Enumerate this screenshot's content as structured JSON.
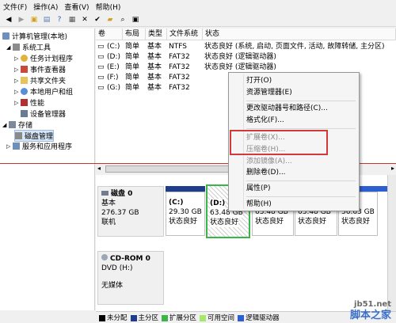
{
  "menubar": [
    "文件(F)",
    "操作(A)",
    "查看(V)",
    "帮助(H)"
  ],
  "toolbar_icons": [
    "back-icon",
    "forward-icon",
    "up-folder-icon",
    "show-tree-icon",
    "help-icon",
    "properties-icon",
    "close-icon",
    "check-icon",
    "open-icon",
    "search-icon",
    "zoom-icon"
  ],
  "tree": {
    "root": "计算机管理(本地)",
    "system_tools": "系统工具",
    "task_scheduler": "任务计划程序",
    "event_viewer": "事件查看器",
    "shared_folders": "共享文件夹",
    "local_users": "本地用户和组",
    "performance": "性能",
    "device_manager": "设备管理器",
    "storage": "存储",
    "disk_management": "磁盘管理",
    "services": "服务和应用程序"
  },
  "volume_table": {
    "headers": [
      "卷",
      "布局",
      "类型",
      "文件系统",
      "状态"
    ],
    "rows": [
      [
        "(C:)",
        "简单",
        "基本",
        "NTFS",
        "状态良好 (系统, 启动, 页面文件, 活动, 故障转储, 主分区)"
      ],
      [
        "(D:)",
        "简单",
        "基本",
        "FAT32",
        "状态良好 (逻辑驱动器)"
      ],
      [
        "(E:)",
        "简单",
        "基本",
        "FAT32",
        "状态良好 (逻辑驱动器)"
      ],
      [
        "(F:)",
        "简单",
        "基本",
        "FAT32",
        ""
      ],
      [
        "(G:)",
        "简单",
        "基本",
        "FAT32",
        ""
      ]
    ]
  },
  "disk0": {
    "name": "磁盘 0",
    "type": "基本",
    "size": "276.37 GB",
    "status": "联机",
    "partitions": [
      {
        "name": "(C:)",
        "size": "29.30 GB",
        "status": "状态良好"
      },
      {
        "name": "(D:)",
        "size": "63.48 GB",
        "status": "状态良好"
      },
      {
        "name": "",
        "size": "63.48 GB",
        "status": "状态良好"
      },
      {
        "name": "",
        "size": "63.48 GB",
        "status": "状态良好"
      },
      {
        "name": "",
        "size": "56.63 GB",
        "status": "状态良好"
      }
    ]
  },
  "cdrom0": {
    "name": "CD-ROM 0",
    "drive": "DVD (H:)",
    "media": "无媒体"
  },
  "legend": [
    "未分配",
    "主分区",
    "扩展分区",
    "可用空间",
    "逻辑驱动器"
  ],
  "colors": {
    "unallocated": "#000000",
    "primary": "#1f3d8a",
    "extended": "#3bb54a",
    "free": "#a6e86a",
    "logical": "#2e5fd0",
    "highlight_box": "#d23a3a"
  },
  "context_menu": {
    "open": "打开(O)",
    "explore": "资源管理器(E)",
    "change_letter": "更改驱动器号和路径(C)...",
    "format": "格式化(F)...",
    "extend": "扩展卷(X)...",
    "shrink": "压缩卷(H)...",
    "add_mirror": "添加镜像(A)...",
    "delete": "删除卷(D)...",
    "properties": "属性(P)",
    "help": "帮助(H)"
  },
  "watermark": {
    "line1": "jb51.net",
    "line2": "脚本之家"
  }
}
